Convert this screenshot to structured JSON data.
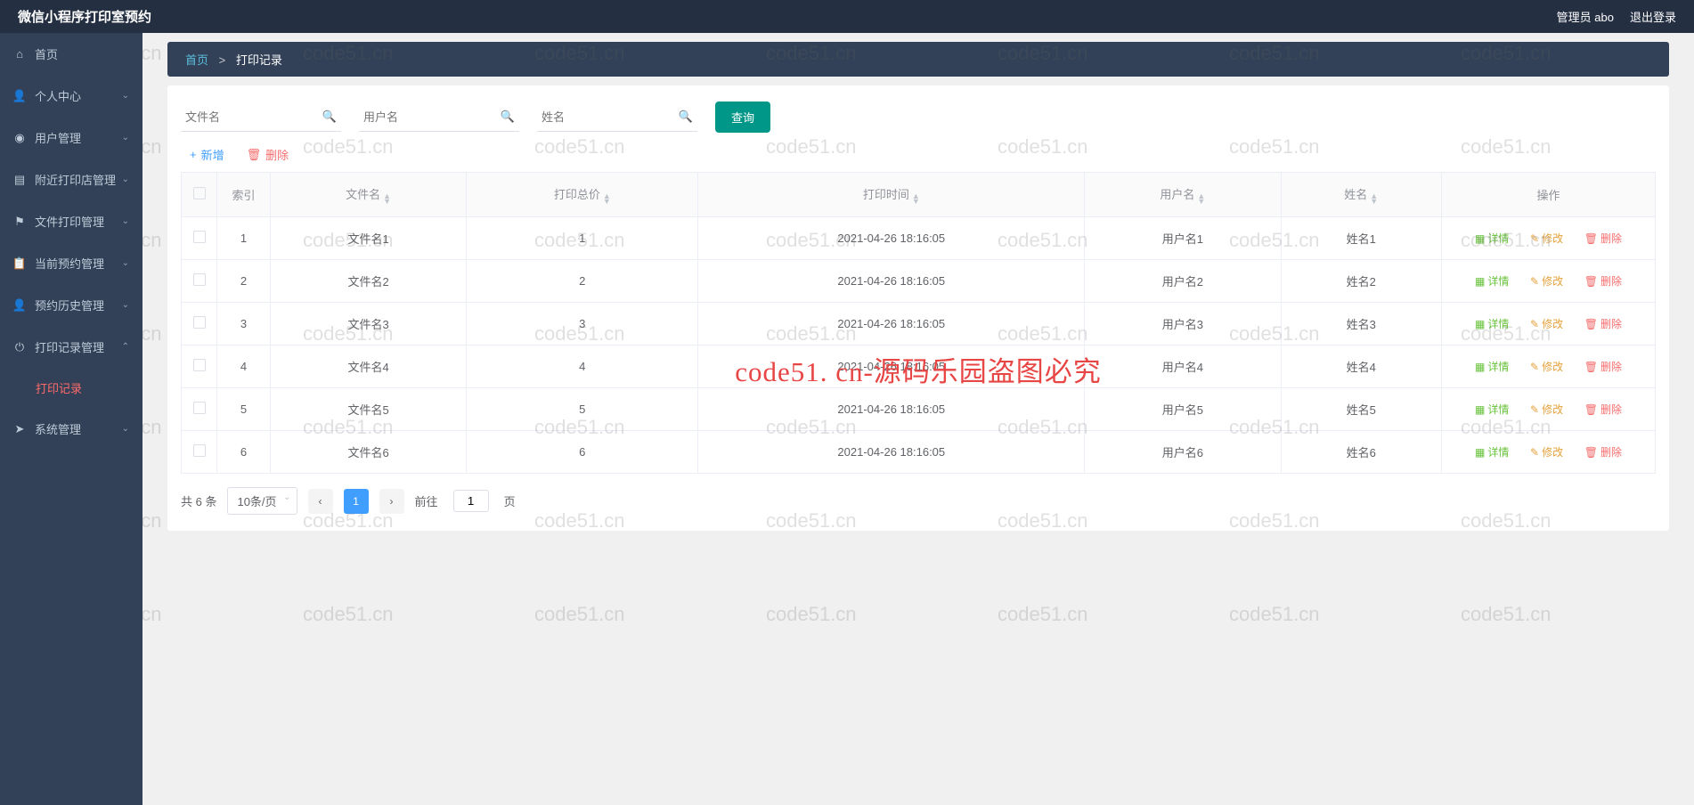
{
  "header": {
    "title": "微信小程序打印室预约",
    "admin_label": "管理员 abo",
    "logout_label": "退出登录"
  },
  "sidebar": {
    "items": [
      {
        "label": "首页",
        "icon": "home"
      },
      {
        "label": "个人中心",
        "icon": "user",
        "expandable": true
      },
      {
        "label": "用户管理",
        "icon": "gauge",
        "expandable": true
      },
      {
        "label": "附近打印店管理",
        "icon": "store",
        "expandable": true
      },
      {
        "label": "文件打印管理",
        "icon": "flag",
        "expandable": true
      },
      {
        "label": "当前预约管理",
        "icon": "clipboard",
        "expandable": true
      },
      {
        "label": "预约历史管理",
        "icon": "history",
        "expandable": true
      },
      {
        "label": "打印记录管理",
        "icon": "power",
        "expandable": true,
        "expanded": true
      },
      {
        "label": "系统管理",
        "icon": "send",
        "expandable": true
      }
    ],
    "subitem_print_record": "打印记录"
  },
  "breadcrumb": {
    "home": "首页",
    "sep": ">",
    "current": "打印记录"
  },
  "search": {
    "filename_placeholder": "文件名",
    "username_placeholder": "用户名",
    "name_placeholder": "姓名",
    "query_btn": "查询"
  },
  "toolbar": {
    "add_label": "新增",
    "delete_label": "删除"
  },
  "table": {
    "headers": {
      "index": "索引",
      "filename": "文件名",
      "total_price": "打印总价",
      "print_time": "打印时间",
      "username": "用户名",
      "name": "姓名",
      "actions": "操作"
    },
    "action_labels": {
      "detail": "详情",
      "edit": "修改",
      "delete": "删除"
    },
    "rows": [
      {
        "index": "1",
        "filename": "文件名1",
        "total_price": "1",
        "print_time": "2021-04-26 18:16:05",
        "username": "用户名1",
        "name": "姓名1"
      },
      {
        "index": "2",
        "filename": "文件名2",
        "total_price": "2",
        "print_time": "2021-04-26 18:16:05",
        "username": "用户名2",
        "name": "姓名2"
      },
      {
        "index": "3",
        "filename": "文件名3",
        "total_price": "3",
        "print_time": "2021-04-26 18:16:05",
        "username": "用户名3",
        "name": "姓名3"
      },
      {
        "index": "4",
        "filename": "文件名4",
        "total_price": "4",
        "print_time": "2021-04-26 18:16:05",
        "username": "用户名4",
        "name": "姓名4"
      },
      {
        "index": "5",
        "filename": "文件名5",
        "total_price": "5",
        "print_time": "2021-04-26 18:16:05",
        "username": "用户名5",
        "name": "姓名5"
      },
      {
        "index": "6",
        "filename": "文件名6",
        "total_price": "6",
        "print_time": "2021-04-26 18:16:05",
        "username": "用户名6",
        "name": "姓名6"
      }
    ]
  },
  "pagination": {
    "total_text": "共 6 条",
    "page_size": "10条/页",
    "current_page": "1",
    "goto_label": "前往",
    "goto_value": "1",
    "page_suffix": "页"
  },
  "watermark": {
    "repeat_text": "code51.cn",
    "center_text": "code51. cn-源码乐园盗图必究"
  }
}
